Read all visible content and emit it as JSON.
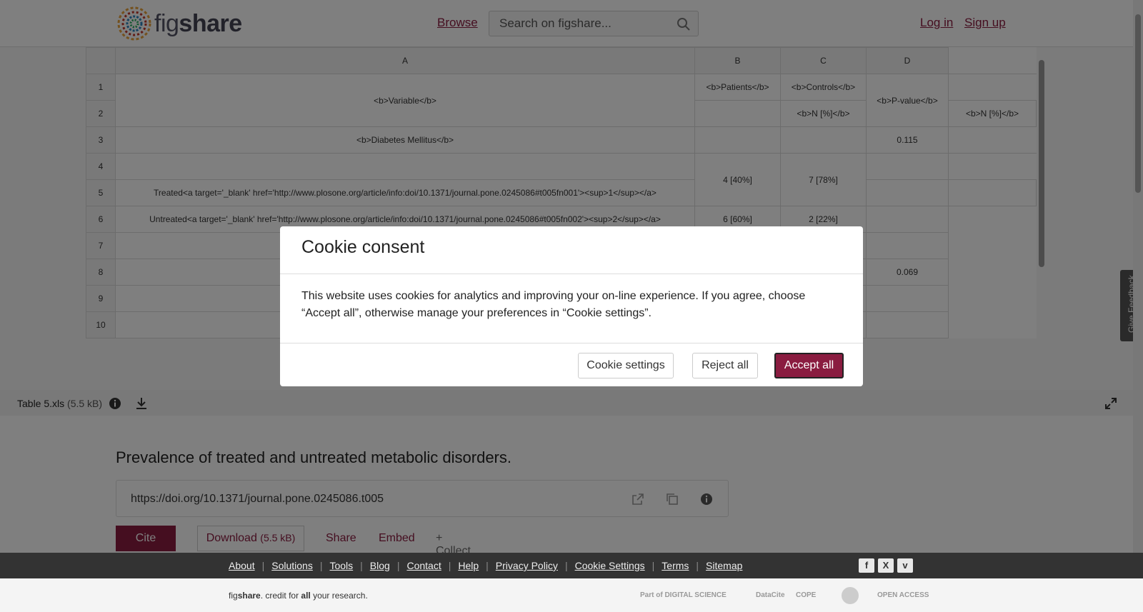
{
  "header": {
    "logo_text_light": "fig",
    "logo_text_bold": "share",
    "browse": "Browse",
    "search_placeholder": "Search on figshare...",
    "login": "Log in",
    "signup": "Sign up"
  },
  "sheet": {
    "columns": [
      "A",
      "B",
      "C",
      "D"
    ],
    "row_numbers": [
      "1",
      "2",
      "3",
      "4",
      "5",
      "6",
      "7",
      "8",
      "9",
      "10"
    ],
    "r1_variable": "<b>Variable</b>",
    "r1_patients": "<b>Patients</b>",
    "r1_controls": "<b>Controls</b>",
    "r1_pvalue": "<b>P-value</b>",
    "r2_n_controls": "<b>N [%]</b>",
    "r2_n_extra": "<b>N [%]</b>",
    "r3_diabetes": "<b>Diabetes Mellitus</b>",
    "r3_p": "0.115",
    "r5_treated": "Treated<a target='_blank' href='http://www.plosone.org/article/info:doi/10.1371/journal.pone.0245086#t005fn001'><sup>1</sup></a>",
    "r45_patients": "4 [40%]",
    "r45_controls": "7 [78%]",
    "r6_untreated": "Untreated<a target='_blank' href='http://www.plosone.org/article/info:doi/10.1371/journal.pone.0245086#t005fn002'><sup>2</sup></a>",
    "r6_patients": "6 [60%]",
    "r6_controls": "2 [22%]",
    "r8_p": "0.069"
  },
  "file": {
    "name": "Table 5.xls",
    "size": "(5.5 kB)"
  },
  "item": {
    "title": "Prevalence of treated and untreated metabolic disorders.",
    "doi": "https://doi.org/10.1371/journal.pone.0245086.t005",
    "cite": "Cite",
    "download": "Download",
    "download_size": "(5.5 kB)",
    "share": "Share",
    "embed": "Embed",
    "collect": "+ Collect"
  },
  "footer": {
    "links": [
      "About",
      "Solutions",
      "Tools",
      "Blog",
      "Contact",
      "Help",
      "Privacy Policy",
      "Cookie Settings",
      "Terms",
      "Sitemap"
    ],
    "credit_fig": "fig",
    "credit_share": "share",
    "credit_mid": ". credit for ",
    "credit_all": "all",
    "credit_end": " your research.",
    "social": [
      "f",
      "X",
      "v"
    ],
    "partners": [
      "Part of DIGITAL SCIENCE",
      "DataCite",
      "COPE",
      "",
      "OPEN ACCESS"
    ]
  },
  "feedback": "Give Feedback",
  "cookie": {
    "title": "Cookie consent",
    "body": "This website uses cookies for analytics and improving your on-line experience. If you agree, choose “Accept all”, otherwise manage your preferences in “Cookie settings”.",
    "settings": "Cookie settings",
    "reject": "Reject all",
    "accept": "Accept all"
  },
  "colors": {
    "brand": "#8a1c40",
    "footer_bg": "#333333"
  }
}
